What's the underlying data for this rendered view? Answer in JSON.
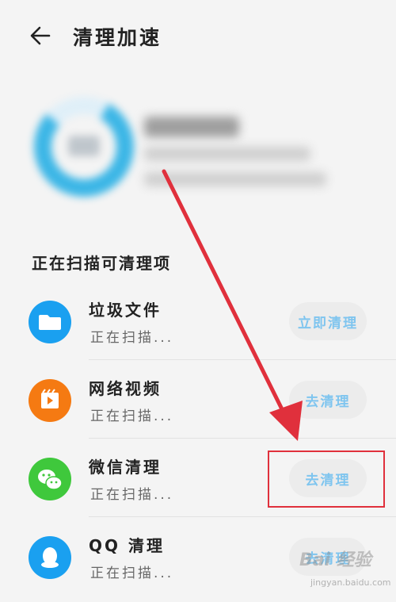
{
  "header": {
    "title": "清理加速"
  },
  "section": {
    "title": "正在扫描可清理项"
  },
  "items": [
    {
      "name": "垃圾文件",
      "status": "正在扫描...",
      "button": "立即清理",
      "icon": "folder-icon",
      "color": "#1aa0f0"
    },
    {
      "name": "网络视频",
      "status": "正在扫描...",
      "button": "去清理",
      "icon": "video-icon",
      "color": "#f57a12"
    },
    {
      "name": "微信清理",
      "status": "正在扫描...",
      "button": "去清理",
      "icon": "wechat-icon",
      "color": "#3fc83c"
    },
    {
      "name": "QQ 清理",
      "status": "正在扫描...",
      "button": "去清理",
      "icon": "qq-icon",
      "color": "#1aa0f0"
    }
  ],
  "watermark": {
    "logo": "Bai 经验",
    "url": "jingyan.baidu.com"
  },
  "colors": {
    "accent": "#7fc5ef",
    "annotation": "#e0303c"
  }
}
